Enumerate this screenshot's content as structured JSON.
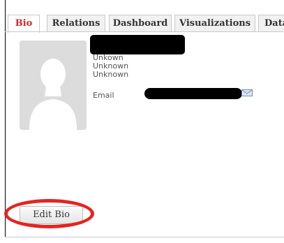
{
  "tabs": [
    {
      "label": "Bio",
      "active": true
    },
    {
      "label": "Relations",
      "active": false
    },
    {
      "label": "Dashboard",
      "active": false
    },
    {
      "label": "Visualizations",
      "active": false
    },
    {
      "label": "Data",
      "active": false
    }
  ],
  "profile": {
    "fields": [
      "Unkown",
      "Unknown",
      "Unknown"
    ],
    "email_label": "Email"
  },
  "actions": {
    "edit_bio_label": "Edit Bio"
  },
  "colors": {
    "active_tab_text": "#d62828",
    "annotation_circle": "#e32520",
    "redaction": "#000000"
  }
}
